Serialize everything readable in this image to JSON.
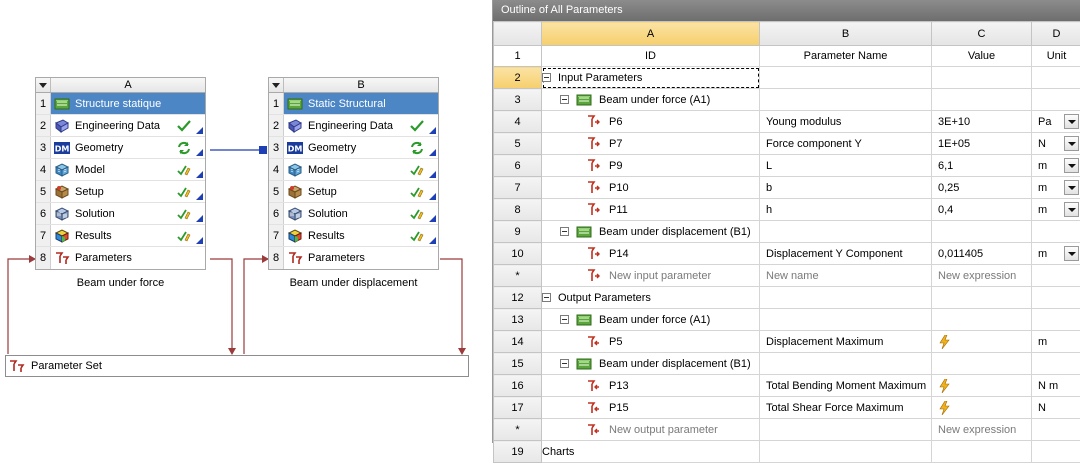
{
  "schematic": {
    "systems": [
      {
        "column": "A",
        "caption": "Beam under force",
        "rows": [
          {
            "num": "1",
            "label": "Structure statique",
            "icon": "static-structural-icon",
            "status": ""
          },
          {
            "num": "2",
            "label": "Engineering Data",
            "icon": "engineering-data-icon",
            "status": "check-icon"
          },
          {
            "num": "3",
            "label": "Geometry",
            "icon": "geometry-dm-icon",
            "status": "refresh-icon"
          },
          {
            "num": "4",
            "label": "Model",
            "icon": "model-icon",
            "status": "update-icon"
          },
          {
            "num": "5",
            "label": "Setup",
            "icon": "setup-icon",
            "status": "update-icon"
          },
          {
            "num": "6",
            "label": "Solution",
            "icon": "solution-icon",
            "status": "update-icon"
          },
          {
            "num": "7",
            "label": "Results",
            "icon": "results-icon",
            "status": "update-icon"
          },
          {
            "num": "8",
            "label": "Parameters",
            "icon": "parameters-icon",
            "status": ""
          }
        ]
      },
      {
        "column": "B",
        "caption": "Beam under displacement",
        "rows": [
          {
            "num": "1",
            "label": "Static Structural",
            "icon": "static-structural-icon",
            "status": ""
          },
          {
            "num": "2",
            "label": "Engineering Data",
            "icon": "engineering-data-icon",
            "status": "check-icon"
          },
          {
            "num": "3",
            "label": "Geometry",
            "icon": "geometry-dm-icon",
            "status": "refresh-icon"
          },
          {
            "num": "4",
            "label": "Model",
            "icon": "model-icon",
            "status": "update-icon"
          },
          {
            "num": "5",
            "label": "Setup",
            "icon": "setup-icon",
            "status": "update-icon"
          },
          {
            "num": "6",
            "label": "Solution",
            "icon": "solution-icon",
            "status": "update-icon"
          },
          {
            "num": "7",
            "label": "Results",
            "icon": "results-icon",
            "status": "update-icon"
          },
          {
            "num": "8",
            "label": "Parameters",
            "icon": "parameters-icon",
            "status": ""
          }
        ]
      }
    ],
    "parameter_set": {
      "label": "Parameter Set",
      "icon": "parameter-set-icon"
    },
    "colors": {
      "title_row": "#4d86c5",
      "link_line": "#1f3fb5",
      "param_line": "#9b3b3b"
    }
  },
  "outline": {
    "title": "Outline of All Parameters",
    "columns": [
      {
        "letter": "A",
        "header": "ID"
      },
      {
        "letter": "B",
        "header": "Parameter Name"
      },
      {
        "letter": "C",
        "header": "Value"
      },
      {
        "letter": "D",
        "header": "Unit"
      }
    ],
    "rows": [
      {
        "num": "2",
        "kind": "group",
        "indent": 0,
        "id": "Input Parameters",
        "expander": true,
        "icon": "",
        "name": "",
        "value": "",
        "unit": "",
        "selected": true
      },
      {
        "num": "3",
        "kind": "group",
        "indent": 1,
        "id": "Beam under force (A1)",
        "expander": true,
        "icon": "static-structural-icon",
        "name": "",
        "value": "",
        "unit": ""
      },
      {
        "num": "4",
        "kind": "param",
        "indent": 2,
        "id": "P6",
        "icon": "input-parameter-icon",
        "name": "Young modulus",
        "value": "3E+10",
        "unit": "Pa",
        "dropdown": true
      },
      {
        "num": "5",
        "kind": "param",
        "indent": 2,
        "id": "P7",
        "icon": "input-parameter-icon",
        "name": "Force component Y",
        "value": "1E+05",
        "unit": "N",
        "dropdown": true
      },
      {
        "num": "6",
        "kind": "param",
        "indent": 2,
        "id": "P9",
        "icon": "input-parameter-icon",
        "name": "L",
        "value": "6,1",
        "unit": "m",
        "dropdown": true
      },
      {
        "num": "7",
        "kind": "param",
        "indent": 2,
        "id": "P10",
        "icon": "input-parameter-icon",
        "name": "b",
        "value": "0,25",
        "unit": "m",
        "dropdown": true
      },
      {
        "num": "8",
        "kind": "param",
        "indent": 2,
        "id": "P11",
        "icon": "input-parameter-icon",
        "name": "h",
        "value": "0,4",
        "unit": "m",
        "dropdown": true
      },
      {
        "num": "9",
        "kind": "group",
        "indent": 1,
        "id": "Beam under displacement (B1)",
        "expander": true,
        "icon": "static-structural-icon",
        "name": "",
        "value": "",
        "unit": ""
      },
      {
        "num": "10",
        "kind": "param",
        "indent": 2,
        "id": "P14",
        "icon": "input-parameter-icon",
        "name": "Displacement Y Component",
        "value": "0,011405",
        "unit": "m",
        "dropdown": true
      },
      {
        "num": "*",
        "kind": "new",
        "indent": 2,
        "id": "New input parameter",
        "icon": "input-parameter-icon",
        "name": "New name",
        "value": "New expression",
        "unit": ""
      },
      {
        "num": "12",
        "kind": "group",
        "indent": 0,
        "id": "Output Parameters",
        "expander": true,
        "icon": "",
        "name": "",
        "value": "",
        "unit": ""
      },
      {
        "num": "13",
        "kind": "group",
        "indent": 1,
        "id": "Beam under force (A1)",
        "expander": true,
        "icon": "static-structural-icon",
        "name": "",
        "value": "",
        "unit": ""
      },
      {
        "num": "14",
        "kind": "param",
        "indent": 2,
        "id": "P5",
        "icon": "output-parameter-icon",
        "name": "Displacement Maximum",
        "value": "",
        "value_icon": "lightning-icon",
        "unit": "m"
      },
      {
        "num": "15",
        "kind": "group",
        "indent": 1,
        "id": "Beam under displacement (B1)",
        "expander": true,
        "icon": "static-structural-icon",
        "name": "",
        "value": "",
        "unit": ""
      },
      {
        "num": "16",
        "kind": "param",
        "indent": 2,
        "id": "P13",
        "icon": "output-parameter-icon",
        "name": "Total Bending Moment Maximum",
        "value": "",
        "value_icon": "lightning-icon",
        "unit": "N m"
      },
      {
        "num": "17",
        "kind": "param",
        "indent": 2,
        "id": "P15",
        "icon": "output-parameter-icon",
        "name": "Total Shear Force Maximum",
        "value": "",
        "value_icon": "lightning-icon",
        "unit": "N"
      },
      {
        "num": "*",
        "kind": "new",
        "indent": 2,
        "id": "New output parameter",
        "icon": "output-parameter-icon",
        "name": "",
        "value": "New expression",
        "unit": ""
      },
      {
        "num": "19",
        "kind": "plain",
        "indent": 0,
        "id": "Charts",
        "icon": "",
        "name": "",
        "value": "",
        "unit": ""
      }
    ]
  }
}
